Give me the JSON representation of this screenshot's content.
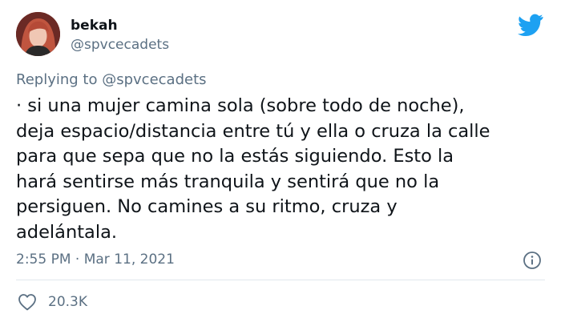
{
  "user": {
    "display_name": "bekah",
    "handle": "@spvcecadets"
  },
  "reply": {
    "prefix": "Replying to",
    "handle": "@spvcecadets"
  },
  "tweet": {
    "text": "· si una mujer camina sola (sobre todo de noche),\ndeja espacio/distancia entre tú y ella o cruza la calle\npara que sepa que no la estás siguiendo. Esto la\nhará sentirse más tranquila y sentirá que no la\npersiguen. No camines a su ritmo, cruza y\nadelántala."
  },
  "meta": {
    "time": "2:55 PM",
    "separator": "·",
    "date": "Mar 11, 2021"
  },
  "stats": {
    "likes": "20.3K"
  },
  "icons": {
    "brand": "twitter-bird-icon",
    "info": "info-icon",
    "like": "heart-icon"
  },
  "colors": {
    "brand": "#1da1f2",
    "text": "#0f1419",
    "secondary": "#5b7083",
    "divider": "#e1e8ed"
  }
}
